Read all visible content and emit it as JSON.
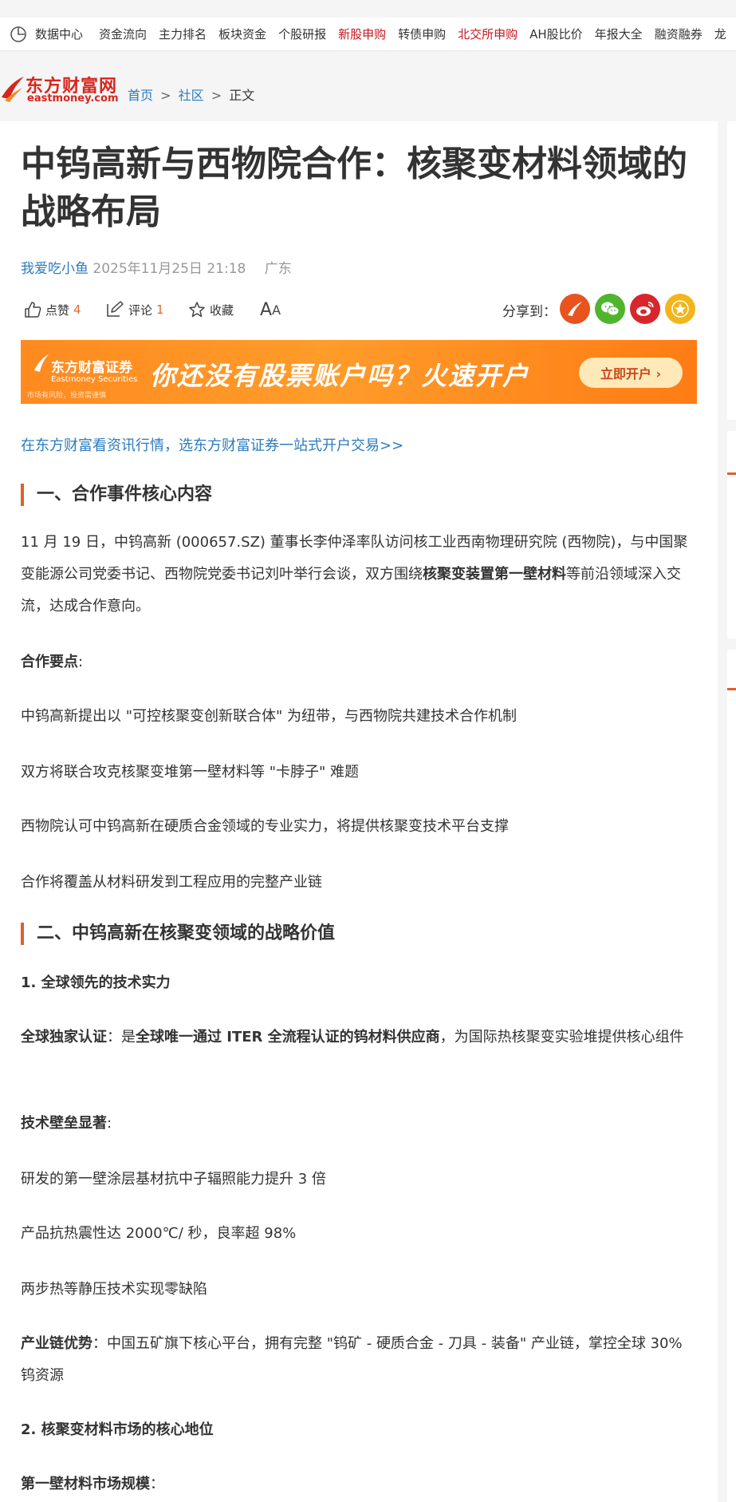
{
  "nav": {
    "data_center": "数据中心",
    "items": [
      {
        "label": "资金流向",
        "highlight": false
      },
      {
        "label": "主力排名",
        "highlight": false
      },
      {
        "label": "板块资金",
        "highlight": false
      },
      {
        "label": "个股研报",
        "highlight": false
      },
      {
        "label": "新股申购",
        "highlight": true
      },
      {
        "label": "转债申购",
        "highlight": false
      },
      {
        "label": "北交所申购",
        "highlight": true
      },
      {
        "label": "AH股比价",
        "highlight": false
      },
      {
        "label": "年报大全",
        "highlight": false
      },
      {
        "label": "融资融券",
        "highlight": false
      },
      {
        "label": "龙",
        "highlight": false
      }
    ]
  },
  "logo": {
    "cn": "东方财富网",
    "en": "eastmoney.com"
  },
  "breadcrumb": {
    "home": "首页",
    "community": "社区",
    "current": "正文",
    "sep": ">"
  },
  "article": {
    "title_line1": "中钨高新与西物院合作：核聚变材料领域的",
    "title_line2": "战略布局",
    "author": "我爱吃小鱼",
    "datetime": "2025年11月25日 21:18",
    "region": "广东"
  },
  "actions": {
    "like_label": "点赞",
    "like_count": "4",
    "comment_label": "评论",
    "comment_count": "1",
    "favorite_label": "收藏",
    "font_big": "A",
    "font_small": "A",
    "share_label": "分享到："
  },
  "banner": {
    "logo_cn": "东方财富证券",
    "logo_en": "Eastmoney Securities",
    "risk": "市场有风险，投资需谨慎",
    "slogan": "你还没有股票账户吗？火速开户",
    "cta": "立即开户 ›"
  },
  "promo": "在东方财富看资讯行情，选东方财富证券一站式开户交易>>",
  "sections": {
    "s1_title": "一、合作事件核心内容",
    "p1_a": "11 月 19 日，中钨高新 (000657.SZ) 董事长李仲泽率队访问核工业西南物理研究院 (西物院)，与中国聚变能源公司党委书记、西物院党委书记刘叶举行会谈，双方围绕",
    "p1_bold": "核聚变装置第一壁材料",
    "p1_b": "等前沿领域深入交流，达成合作意向。",
    "key_points_label": "合作要点",
    "colon": ":",
    "kp1": "中钨高新提出以 \"可控核聚变创新联合体\" 为纽带，与西物院共建技术合作机制",
    "kp2": "双方将联合攻克核聚变堆第一壁材料等 \"卡脖子\" 难题",
    "kp3": "西物院认可中钨高新在硬质合金领域的专业实力，将提供核聚变技术平台支撑",
    "kp4": "合作将覆盖从材料研发到工程应用的完整产业链",
    "s2_title": "二、中钨高新在核聚变领域的战略价值",
    "sub1": "1. 全球领先的技术实力",
    "cert_label": "全球独家认证",
    "cert_mid": "：是",
    "cert_bold": "全球唯一通过 ITER 全流程认证的钨材料供应商",
    "cert_tail": "，为国际热核聚变实验堆提供核心组件",
    "barrier_label": "技术壁垒显著",
    "b1": "研发的第一壁涂层基材抗中子辐照能力提升 3 倍",
    "b2": "产品抗热震性达 2000℃/ 秒，良率超 98%",
    "b3": "两步热等静压技术实现零缺陷",
    "chain_label": "产业链优势",
    "chain_text": "：中国五矿旗下核心平台，拥有完整 \"钨矿 - 硬质合金 - 刀具 - 装备\" 产业链，掌控全球 30% 钨资源",
    "sub2": "2. 核聚变材料市场的核心地位",
    "market_label": "第一壁材料市场规模",
    "market_colon": "："
  },
  "colors": {
    "accent": "#e0602a",
    "link": "#2c7bbf",
    "nav_red": "#c5161d",
    "brand_red": "#d7261e"
  },
  "icons": {
    "clock": "clock-icon",
    "like": "thumbs-up-icon",
    "comment": "comment-edit-icon",
    "favorite": "star-outline-icon",
    "share": [
      "eastmoney-share-icon",
      "wechat-icon",
      "weibo-icon",
      "star-share-icon"
    ]
  }
}
